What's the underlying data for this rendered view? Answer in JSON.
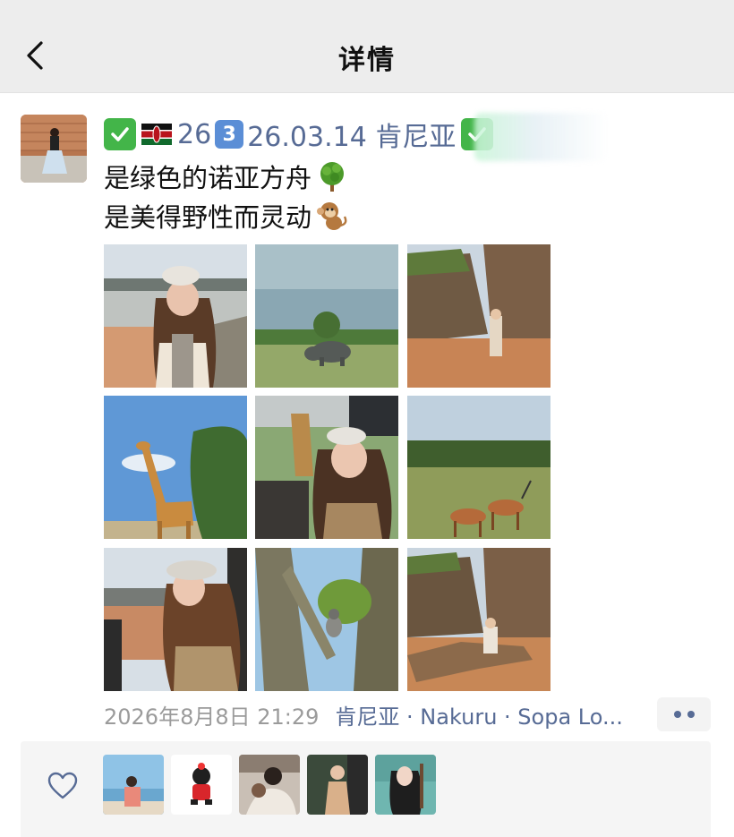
{
  "nav": {
    "title": "详情",
    "back_icon": "chevron-left-icon"
  },
  "post": {
    "name_prefix": "26",
    "name_keycap": "3",
    "name_suffix": "26.03.14 肯尼亚",
    "line1": "是绿色的诺亚方舟",
    "line2": "是美得野性而灵动",
    "line1_emoji": "tree-icon",
    "line2_emoji": "monkey-icon",
    "photos": [
      {
        "desc": "woman-by-lake"
      },
      {
        "desc": "rhino-grassland"
      },
      {
        "desc": "woman-canyon"
      },
      {
        "desc": "giraffe-tree"
      },
      {
        "desc": "woman-in-safari-car"
      },
      {
        "desc": "antelopes-savanna"
      },
      {
        "desc": "woman-window-lake"
      },
      {
        "desc": "monkey-in-tree"
      },
      {
        "desc": "woman-sitting-log"
      }
    ]
  },
  "meta": {
    "time": "2026年8月8日 21:29",
    "location": "肯尼亚 · Nakuru · Sopa Lo..."
  },
  "likes": {
    "icon": "heart-icon",
    "avatars": 5
  },
  "colors": {
    "link": "#576b95",
    "nav_bg": "#ededed",
    "likes_bg": "#f5f5f5",
    "check": "#43b549"
  }
}
